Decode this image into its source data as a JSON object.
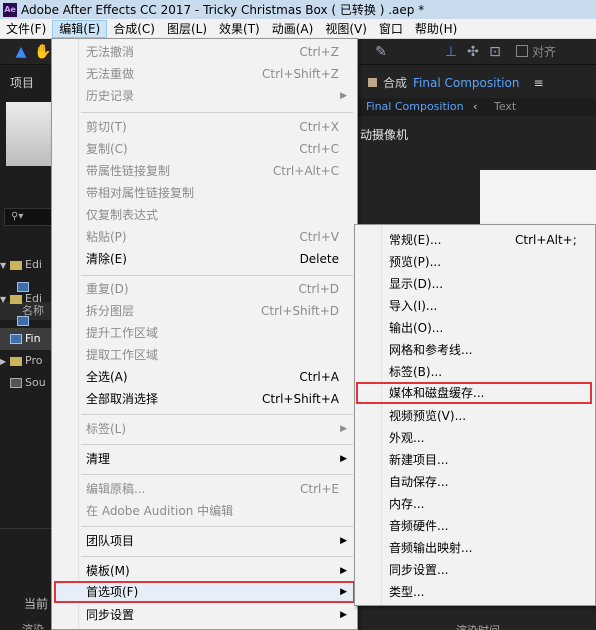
{
  "window": {
    "title": "Adobe After Effects CC 2017 - Tricky Christmas Box ( 已转换 ) .aep *",
    "app_badge": "Ae"
  },
  "menubar": [
    "文件(F)",
    "编辑(E)",
    "合成(C)",
    "图层(L)",
    "效果(T)",
    "动画(A)",
    "视图(V)",
    "窗口",
    "帮助(H)"
  ],
  "toolbar": {
    "align_label": "对齐"
  },
  "project": {
    "title": "项目",
    "column_name": "名称",
    "rows": [
      "Edi",
      "Edi",
      "Fin",
      "Pro",
      "Sou"
    ],
    "bottom_text": "当前",
    "footer": "渲染"
  },
  "composition": {
    "tab_prefix": "合成",
    "name": "Final Composition",
    "viewer_name": "Final Composition",
    "viewer_text": "Text",
    "camera_label": "动摄像机",
    "footer": "渲染时间"
  },
  "edit_menu": {
    "items": [
      {
        "label": "无法撤消",
        "shortcut": "Ctrl+Z"
      },
      {
        "label": "无法重做",
        "shortcut": "Ctrl+Shift+Z"
      },
      {
        "label": "历史记录"
      },
      {
        "label": "剪切(T)",
        "shortcut": "Ctrl+X"
      },
      {
        "label": "复制(C)",
        "shortcut": "Ctrl+C"
      },
      {
        "label": "带属性链接复制",
        "shortcut": "Ctrl+Alt+C"
      },
      {
        "label": "带相对属性链接复制"
      },
      {
        "label": "仅复制表达式"
      },
      {
        "label": "粘贴(P)",
        "shortcut": "Ctrl+V"
      },
      {
        "label": "清除(E)",
        "shortcut": "Delete"
      },
      {
        "label": "重复(D)",
        "shortcut": "Ctrl+D"
      },
      {
        "label": "拆分图层",
        "shortcut": "Ctrl+Shift+D"
      },
      {
        "label": "提升工作区域"
      },
      {
        "label": "提取工作区域"
      },
      {
        "label": "全选(A)",
        "shortcut": "Ctrl+A"
      },
      {
        "label": "全部取消选择",
        "shortcut": "Ctrl+Shift+A"
      },
      {
        "label": "标签(L)"
      },
      {
        "label": "清理"
      },
      {
        "label": "编辑原稿...",
        "shortcut": "Ctrl+E"
      },
      {
        "label": "在 Adobe Audition 中编辑"
      },
      {
        "label": "团队项目"
      },
      {
        "label": "模板(M)"
      },
      {
        "label": "首选项(F)"
      },
      {
        "label": "同步设置"
      }
    ]
  },
  "preferences_menu": {
    "items": [
      {
        "label": "常规(E)...",
        "shortcut": "Ctrl+Alt+;"
      },
      {
        "label": "预览(P)..."
      },
      {
        "label": "显示(D)..."
      },
      {
        "label": "导入(I)..."
      },
      {
        "label": "输出(O)..."
      },
      {
        "label": "网格和参考线..."
      },
      {
        "label": "标签(B)..."
      },
      {
        "label": "媒体和磁盘缓存..."
      },
      {
        "label": "视频预览(V)..."
      },
      {
        "label": "外观..."
      },
      {
        "label": "新建项目..."
      },
      {
        "label": "自动保存..."
      },
      {
        "label": "内存..."
      },
      {
        "label": "音频硬件..."
      },
      {
        "label": "音频输出映射..."
      },
      {
        "label": "同步设置..."
      },
      {
        "label": "类型..."
      }
    ]
  }
}
